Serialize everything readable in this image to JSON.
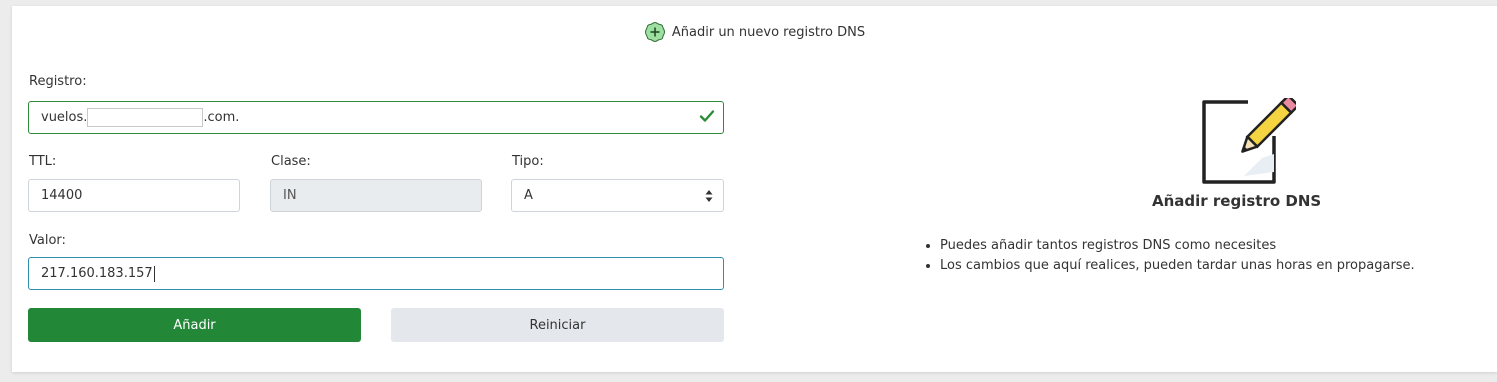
{
  "header": {
    "title": "Añadir un nuevo registro DNS",
    "icon": "plus-circle-icon"
  },
  "form": {
    "registro_label": "Registro:",
    "registro_prefix": "vuelos.",
    "registro_suffix": ".com.",
    "ttl_label": "TTL:",
    "ttl_value": "14400",
    "clase_label": "Clase:",
    "clase_value": "IN",
    "tipo_label": "Tipo:",
    "tipo_value": "A",
    "valor_label": "Valor:",
    "valor_value": "217.160.183.157",
    "add_button": "Añadir",
    "reset_button": "Reiniciar"
  },
  "info": {
    "icon": "pencil-edit-icon",
    "title": "Añadir registro DNS",
    "bullets": [
      "Puedes añadir tantos registros DNS como necesites",
      "Los cambios que aquí realices, pueden tardar unas horas en propagarse."
    ]
  },
  "colors": {
    "primary": "#228838",
    "valid_border": "#2e8b3a",
    "focus_border": "#2d8fb0"
  }
}
